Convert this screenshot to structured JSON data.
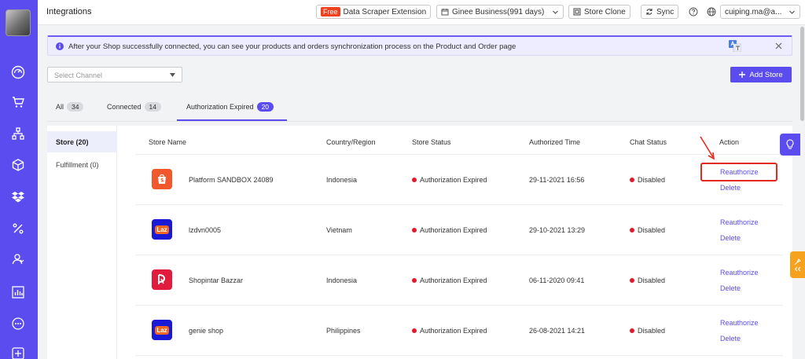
{
  "header": {
    "title": "Integrations",
    "free_badge": "Free",
    "scraper_label": "Data Scraper Extension",
    "business_label": "Ginee Business(991 days)",
    "store_clone_label": "Store Clone",
    "sync_label": "Sync",
    "user_email": "cuiping.ma@a..."
  },
  "notice": {
    "text": "After your Shop successfully connected, you can see your products and orders synchronization process on the Product and Order page"
  },
  "toolbar": {
    "channel_placeholder": "Select Channel",
    "add_store_label": "Add Store"
  },
  "tabs": [
    {
      "label": "All",
      "count": "34"
    },
    {
      "label": "Connected",
      "count": "14"
    },
    {
      "label": "Authorization Expired",
      "count": "20"
    }
  ],
  "left_nav": {
    "store": "Store (20)",
    "fulfillment": "Fulfillment (0)"
  },
  "table": {
    "columns": [
      "Store Name",
      "Country/Region",
      "Store Status",
      "Authorized Time",
      "Chat Status",
      "Action"
    ],
    "rows": [
      {
        "logo": "shopee",
        "name": "Platform SANDBOX 24089",
        "country": "Indonesia",
        "status": "Authorization Expired",
        "time": "29-11-2021 16:56",
        "chat": "Disabled",
        "action1": "Reauthorize",
        "action2": "Delete"
      },
      {
        "logo": "lazada",
        "name": "lzdvn0005",
        "country": "Vietnam",
        "status": "Authorization Expired",
        "time": "29-10-2021 13:29",
        "chat": "Disabled",
        "action1": "Reauthorize",
        "action2": "Delete"
      },
      {
        "logo": "shopintar",
        "name": "Shopintar Bazzar",
        "country": "Indonesia",
        "status": "Authorization Expired",
        "time": "06-11-2020 09:41",
        "chat": "Disabled",
        "action1": "Reauthorize",
        "action2": "Delete"
      },
      {
        "logo": "lazada",
        "name": "genie shop",
        "country": "Philippines",
        "status": "Authorization Expired",
        "time": "26-08-2021 14:21",
        "chat": "Disabled",
        "action1": "Reauthorize",
        "action2": "Delete"
      }
    ]
  },
  "logos": {
    "lazada_text": "Laz"
  },
  "colors": {
    "accent": "#5b4cf0",
    "status_red": "#e2192c",
    "shopee": "#f1582c",
    "lazada": "#1a1ad6",
    "shopintar": "#e01b3c"
  },
  "icons": [
    "dashboard-icon",
    "cart-icon",
    "hierarchy-icon",
    "box-icon",
    "dropbox-icon",
    "percent-icon",
    "users-icon",
    "bar-chart-icon",
    "chat-icon",
    "plus-square-icon"
  ]
}
